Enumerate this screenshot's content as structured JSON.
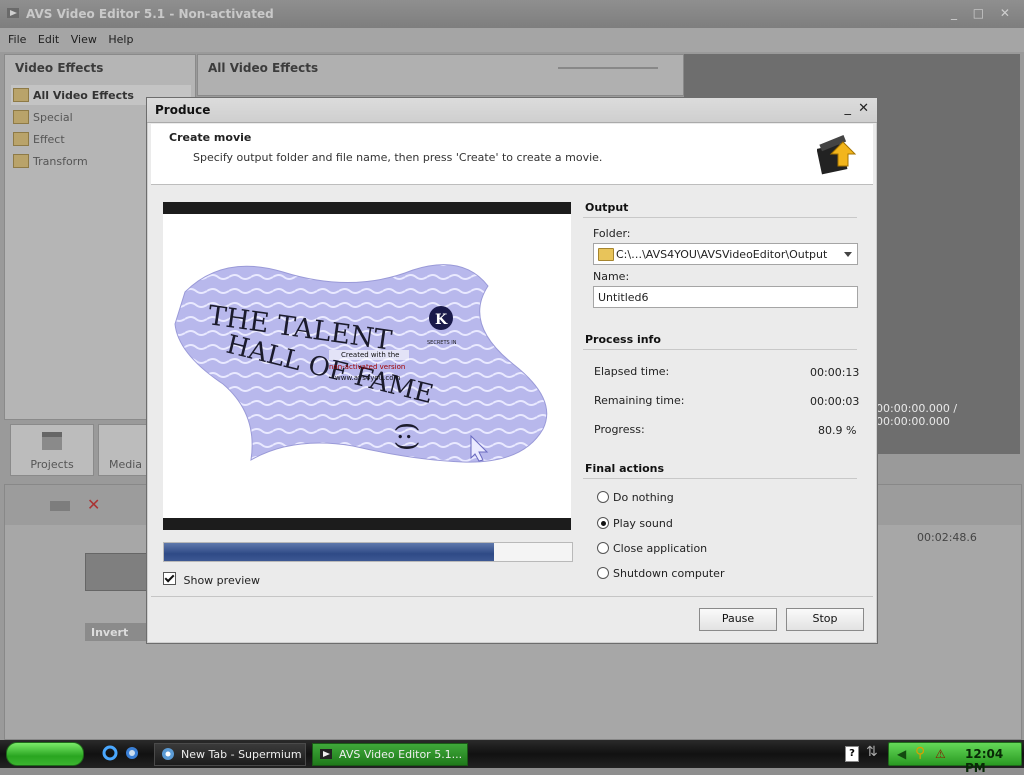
{
  "app": {
    "title": "AVS Video Editor 5.1 - Non-activated",
    "menu": [
      "File",
      "Edit",
      "View",
      "Help"
    ],
    "left_panel_title": "Video Effects",
    "effects": [
      "All Video Effects",
      "Special",
      "Effect",
      "Transform"
    ],
    "mid_panel_title": "All Video Effects",
    "buttons": {
      "projects": "Projects",
      "media": "Media L"
    },
    "timecode": "00:00:00.000 / 00:00:00.000",
    "timeline_time": "00:02:48.6",
    "track_label": "Invert"
  },
  "dialog": {
    "title": "Produce",
    "heading": "Create movie",
    "subheading": "Specify output folder and file name, then press 'Create' to create a movie.",
    "preview": {
      "line1": "THE TALENT",
      "line2": "HALL OF FAME",
      "line3": "(:)",
      "badge": "SECRETS IN",
      "watermark1": "Created with the",
      "watermark2": "non-activated version",
      "watermark3": "www.avs4you.com"
    },
    "progress_fraction": 0.809,
    "show_preview_label": "Show preview",
    "show_preview_checked": true,
    "output": {
      "title": "Output",
      "folder_label": "Folder:",
      "folder_value": "C:\\…\\AVS4YOU\\AVSVideoEditor\\Output",
      "name_label": "Name:",
      "name_value": "Untitled6"
    },
    "process": {
      "title": "Process info",
      "elapsed_label": "Elapsed time:",
      "elapsed_value": "00:00:13",
      "remaining_label": "Remaining time:",
      "remaining_value": "00:00:03",
      "progress_label": "Progress:",
      "progress_value": "80.9 %"
    },
    "final": {
      "title": "Final actions",
      "options": [
        "Do nothing",
        "Play sound",
        "Close application",
        "Shutdown computer"
      ],
      "selected": "Play sound"
    },
    "pause_label": "Pause",
    "stop_label": "Stop"
  },
  "taskbar": {
    "tasks": [
      "New Tab - Supermium",
      "AVS Video Editor 5.1..."
    ],
    "clock": "12:04 PM"
  }
}
